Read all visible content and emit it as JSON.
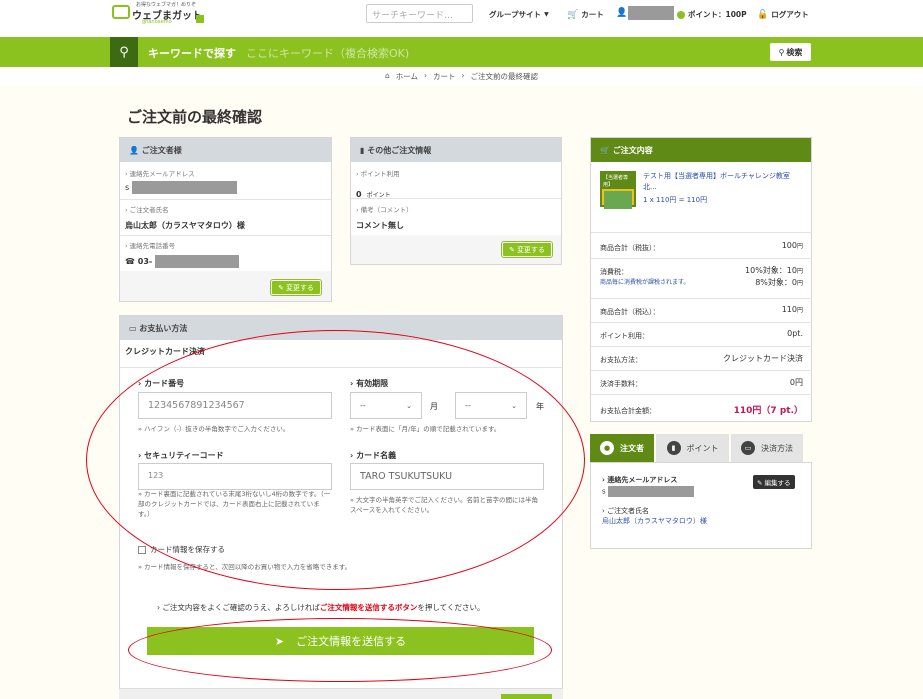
{
  "header": {
    "logo_text": "ウェブまガット",
    "logo_tagline": "お得なウェブマガ！めりぞ",
    "logo_sub": "ghanoaemo",
    "search_placeholder": "サーチキーワード…",
    "group_site": "グループサイト",
    "cart": "カート",
    "points": "ポイント：100P",
    "logout": "ログアウト"
  },
  "keyword_bar": {
    "label": "キーワードで探す",
    "placeholder": "ここにキーワード（複合検索OK)",
    "button": "検索"
  },
  "breadcrumb": [
    "ホーム",
    "カート",
    "ご注文前の最終確認"
  ],
  "page_title": "ご注文前の最終確認",
  "orderer_panel": {
    "title": "ご注文者様",
    "email_label": "連絡先メールアドレス",
    "email_prefix": "s",
    "name_label": "ご注文者氏名",
    "name_value": "烏山太郎（カラスヤマタロウ）様",
    "phone_label": "連絡先電話番号",
    "phone_prefix": "03-",
    "change_button": "変更する"
  },
  "other_panel": {
    "title": "その他ご注文情報",
    "points_label": "ポイント利用",
    "points_value": "0",
    "points_unit": "ポイント",
    "remarks_label": "備考（コメント）",
    "remarks_value": "コメント無し",
    "change_button": "変更する"
  },
  "payment_panel": {
    "title": "お支払い方法",
    "method": "クレジットカード決済",
    "card_number_label": "カード番号",
    "card_number_value": "1234567891234567",
    "card_number_hint": "ハイフン（-）抜きの半角数字でご入力ください。",
    "expiry_label": "有効期限",
    "expiry_month": "--",
    "expiry_month_unit": "月",
    "expiry_year": "--",
    "expiry_year_unit": "年",
    "expiry_hint": "カード表面に「月/年」の順で記載されています。",
    "cvc_label": "セキュリティーコード",
    "cvc_value": "123",
    "cvc_hint_1": "カード裏面に記載されている末尾3桁ないし4桁の数字です。",
    "cvc_hint_2": "（一部のクレジットカードでは、カード表面右上に記載されています。）",
    "holder_label": "カード名義",
    "holder_value": "TARO TSUKUTSUKU",
    "holder_hint": "大文字の半角英字でご記入ください。名前と苗字の間には半角スペースを入れてください。",
    "save_card_label": "カード情報を保存する",
    "save_card_hint": "カード情報を保存すると、次回以降のお買い物で入力を省略できます。"
  },
  "confirm": {
    "text_before": "ご注文内容をよくご確認のうえ、よろしければ",
    "text_highlight": "ご注文情報を送信するボタン",
    "text_after": "を押してください。",
    "submit_button": "ご注文情報を送信する"
  },
  "order_summary": {
    "title": "ご注文内容",
    "item_thumb_label": "【当選者専用】",
    "item_name": "テスト用【当選者専用】ボールチャレンジ教室北...",
    "item_price": "1 x 110円 = 110円",
    "rows": {
      "subtotal_ex_label": "商品合計（税抜）：",
      "subtotal_ex_value": "100",
      "tax_label": "消費税：",
      "tax_note": "商品毎に消費税が課税されます。",
      "tax_value_1": "10%対象：10",
      "tax_value_2": "8%対象：0",
      "subtotal_in_label": "商品合計（税込）：",
      "subtotal_in_value": "110",
      "points_label": "ポイント利用：",
      "points_value": "0pt.",
      "payment_label": "お支払方法：",
      "payment_value": "クレジットカード決済",
      "fee_label": "決済手数料：",
      "fee_value": "0円",
      "total_label": "お支払合計金額：",
      "total_value": "110円（7 pt.）",
      "yen": "円"
    }
  },
  "tabs": {
    "orderer": "注文者",
    "points": "ポイント",
    "payment": "決済方法"
  },
  "tab_content": {
    "email_label": "連絡先メールアドレス",
    "email_prefix": "s",
    "edit_button": "編集する",
    "name_label": "ご注文者氏名",
    "name_value": "烏山太郎（カラスヤマタロウ）様"
  },
  "colors": {
    "brand_green": "#8cc21f",
    "dark_green": "#3d6b12",
    "highlight_red": "#e60012",
    "total_color": "#c2185b"
  }
}
